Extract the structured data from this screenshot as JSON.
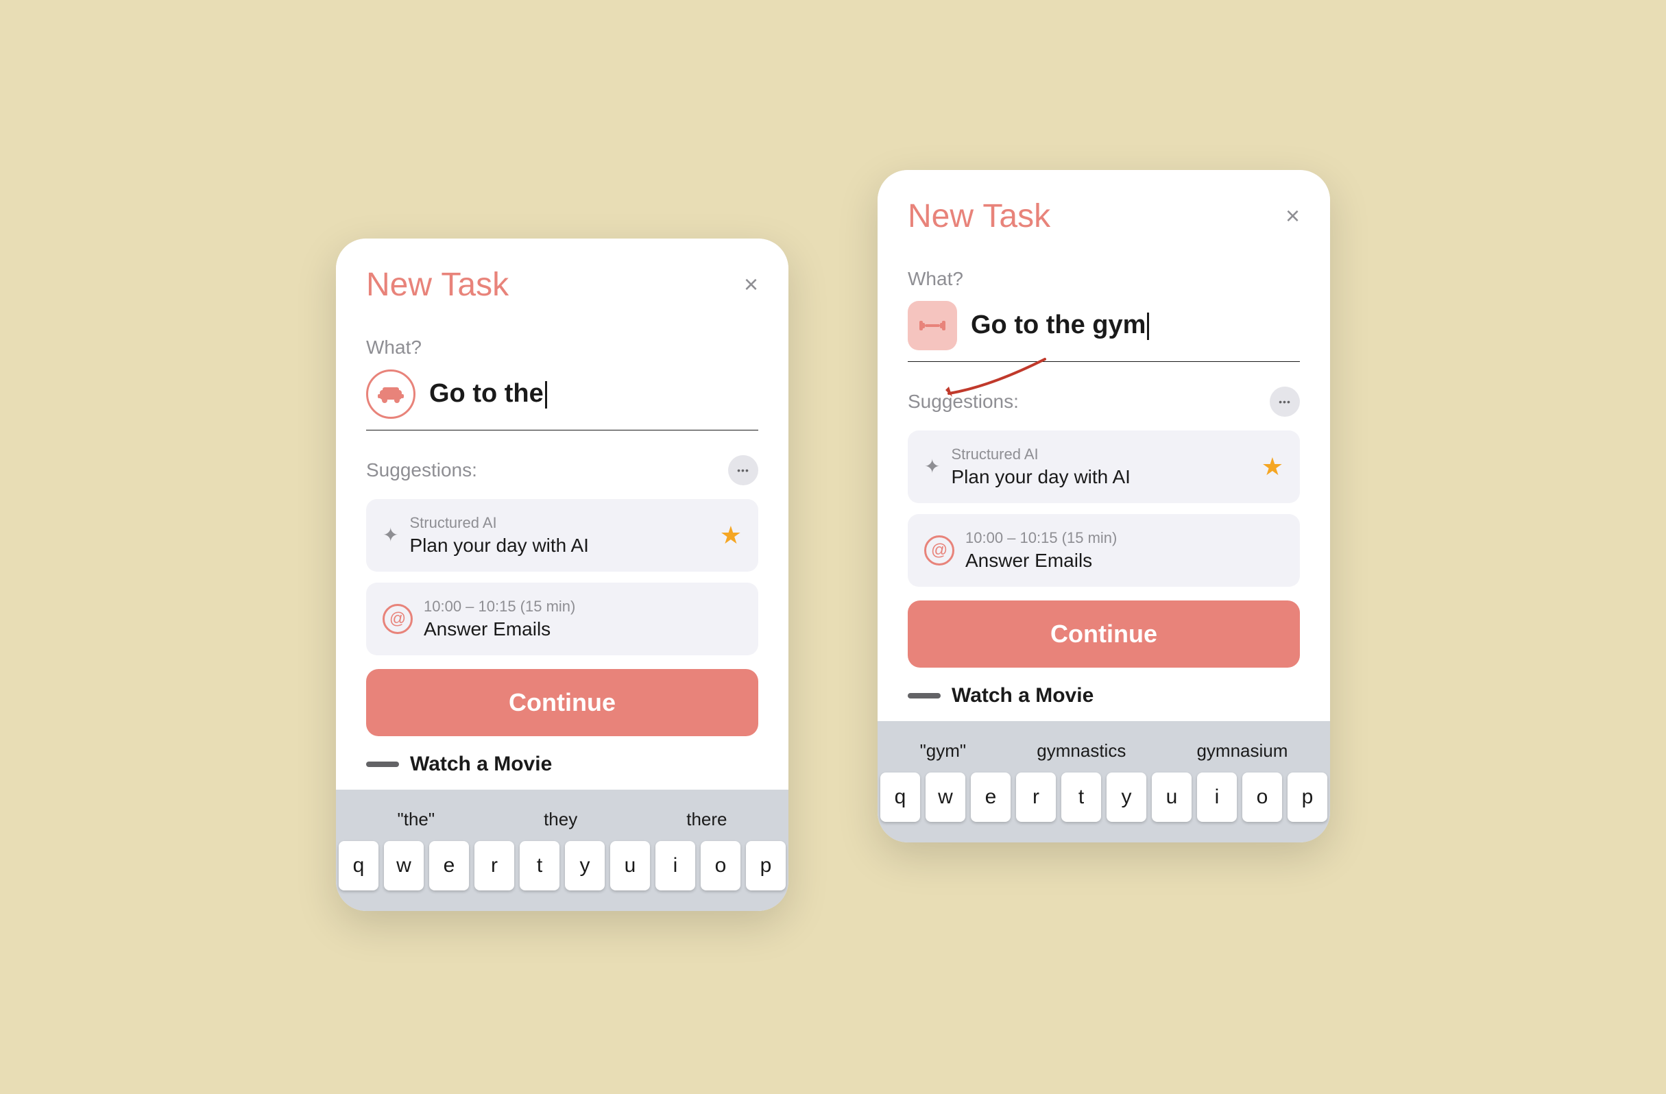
{
  "background": "#e8ddb5",
  "left_panel": {
    "title_bold": "New",
    "title_light": "Task",
    "close": "×",
    "what_label": "What?",
    "input_value": "Go to the",
    "suggestions_label": "Suggestions:",
    "suggestions": [
      {
        "id": "structured-ai",
        "category": "Structured AI",
        "text": "Plan your day with AI",
        "starred": true
      },
      {
        "id": "answer-emails",
        "time": "10:00 – 10:15 (15 min)",
        "text": "Answer Emails",
        "starred": false
      }
    ],
    "continue_label": "Continue",
    "watch_movie": "Watch a Movie",
    "keyboard_suggestions": [
      "\"the\"",
      "they",
      "there"
    ]
  },
  "right_panel": {
    "title_bold": "New",
    "title_light": "Task",
    "close": "×",
    "what_label": "What?",
    "input_value": "Go to the gym",
    "suggestions_label": "Suggestions:",
    "suggestions": [
      {
        "id": "structured-ai",
        "category": "Structured AI",
        "text": "Plan your day with AI",
        "starred": true
      },
      {
        "id": "answer-emails",
        "time": "10:00 – 10:15 (15 min)",
        "text": "Answer Emails",
        "starred": false
      }
    ],
    "continue_label": "Continue",
    "watch_movie": "Watch a Movie",
    "keyboard_suggestions": [
      "\"gym\"",
      "gymnastics",
      "gymnasium"
    ],
    "keyboard_row": [
      "q",
      "w",
      "e",
      "r",
      "t",
      "y",
      "u",
      "i",
      "o",
      "p"
    ]
  }
}
